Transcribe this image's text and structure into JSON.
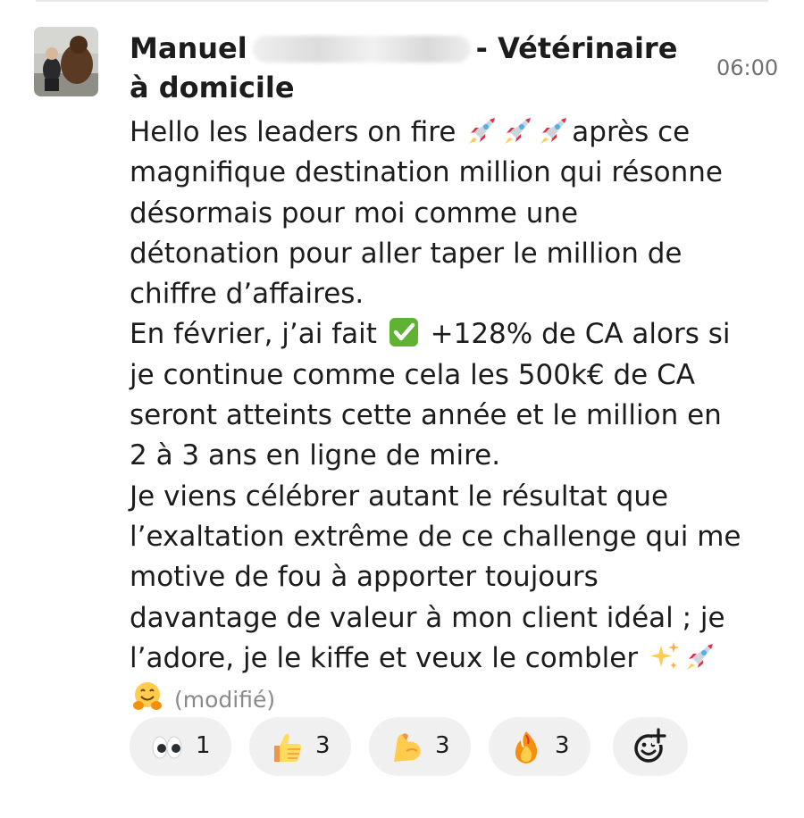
{
  "message": {
    "sender_first": "Manuel",
    "sender_suffix": "- Vétérinaire à domicile",
    "time": "06:00",
    "lines": {
      "l1a": "Hello les leaders on fire",
      "l1b": "après ce",
      "l2": "magnifique destination million qui résonne",
      "l3": "désormais pour moi comme une",
      "l4": "détonation pour aller taper le million de",
      "l5": "chiffre d’affaires.",
      "l6a": "En février, j’ai fait",
      "l6b": "+128% de CA alors si",
      "l7": "je continue comme cela les 500k€ de CA",
      "l8": "seront atteints cette année et le million en",
      "l9": "2 à 3 ans en ligne de mire.",
      "l10": "Je viens célébrer autant le résultat que",
      "l11": "l’exaltation extrême de ce challenge qui me",
      "l12": "motive de fou à apporter toujours",
      "l13": "davantage de valeur à mon client idéal ; je",
      "l14": "l’adore, je le kiffe et veux le combler"
    },
    "edited_label": "(modifié)"
  },
  "reactions": [
    {
      "icon": "eyes-emoji-icon",
      "count": "1"
    },
    {
      "icon": "thumbs-up-emoji-icon",
      "count": "3"
    },
    {
      "icon": "flexed-biceps-emoji-icon",
      "count": "3"
    },
    {
      "icon": "fire-emoji-icon",
      "count": "3"
    }
  ],
  "add_reaction_icon": "add-reaction-icon",
  "colors": {
    "text": "#1d1c1d",
    "timestamp": "#707070",
    "reaction_pill": "#f0f0f0",
    "check_green": "#5fb233"
  }
}
